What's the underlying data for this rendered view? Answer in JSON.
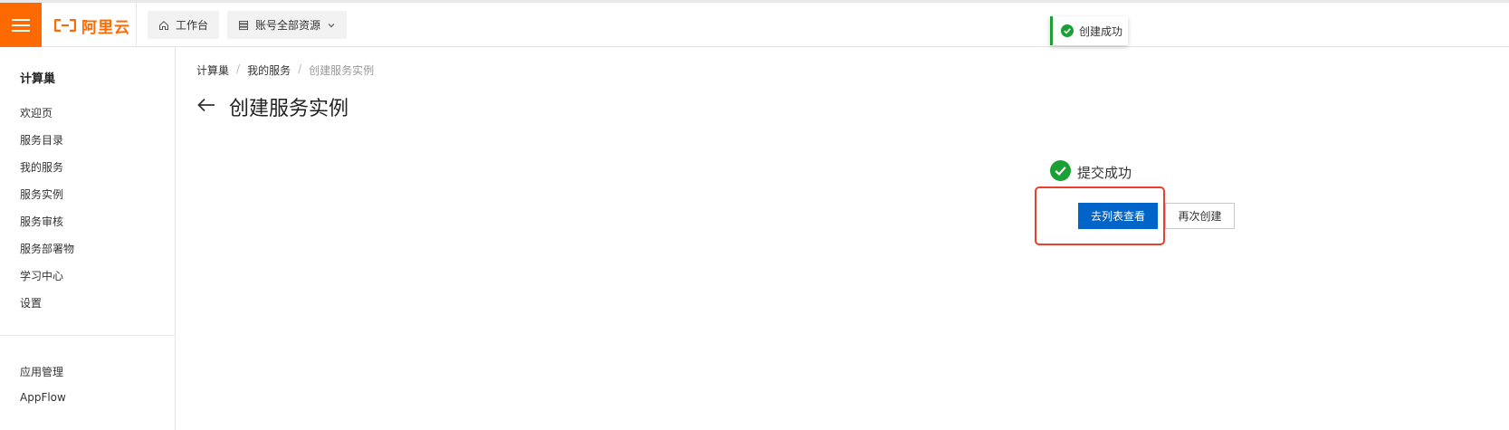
{
  "header": {
    "menu_icon": "hamburger-icon",
    "logo_icon": "aliyun-logo-icon",
    "logo_text": "阿里云",
    "workbench_label": "工作台",
    "workbench_icon": "home-icon",
    "resources_label": "账号全部资源",
    "resources_icon": "database-icon",
    "resources_chevron": "chevron-down-icon",
    "brand_color": "#ff6a00"
  },
  "toast": {
    "text": "创建成功",
    "icon": "check-circle-icon",
    "color": "#1aa035"
  },
  "sidebar": {
    "title": "计算巢",
    "items": [
      {
        "label": "欢迎页"
      },
      {
        "label": "服务目录"
      },
      {
        "label": "我的服务"
      },
      {
        "label": "服务实例"
      },
      {
        "label": "服务审核"
      },
      {
        "label": "服务部署物"
      },
      {
        "label": "学习中心"
      },
      {
        "label": "设置"
      }
    ],
    "bottom_items": [
      {
        "label": "应用管理"
      },
      {
        "label": "AppFlow"
      }
    ]
  },
  "breadcrumb": [
    "计算巢",
    "我的服务",
    "创建服务实例"
  ],
  "page": {
    "title": "创建服务实例",
    "back_icon": "arrow-left-icon"
  },
  "result": {
    "status_text": "提交成功",
    "status_icon": "check-circle-icon",
    "primary_button": "去列表查看",
    "secondary_button": "再次创建",
    "primary_color": "#0064c8",
    "highlight_color": "#e8412c"
  }
}
